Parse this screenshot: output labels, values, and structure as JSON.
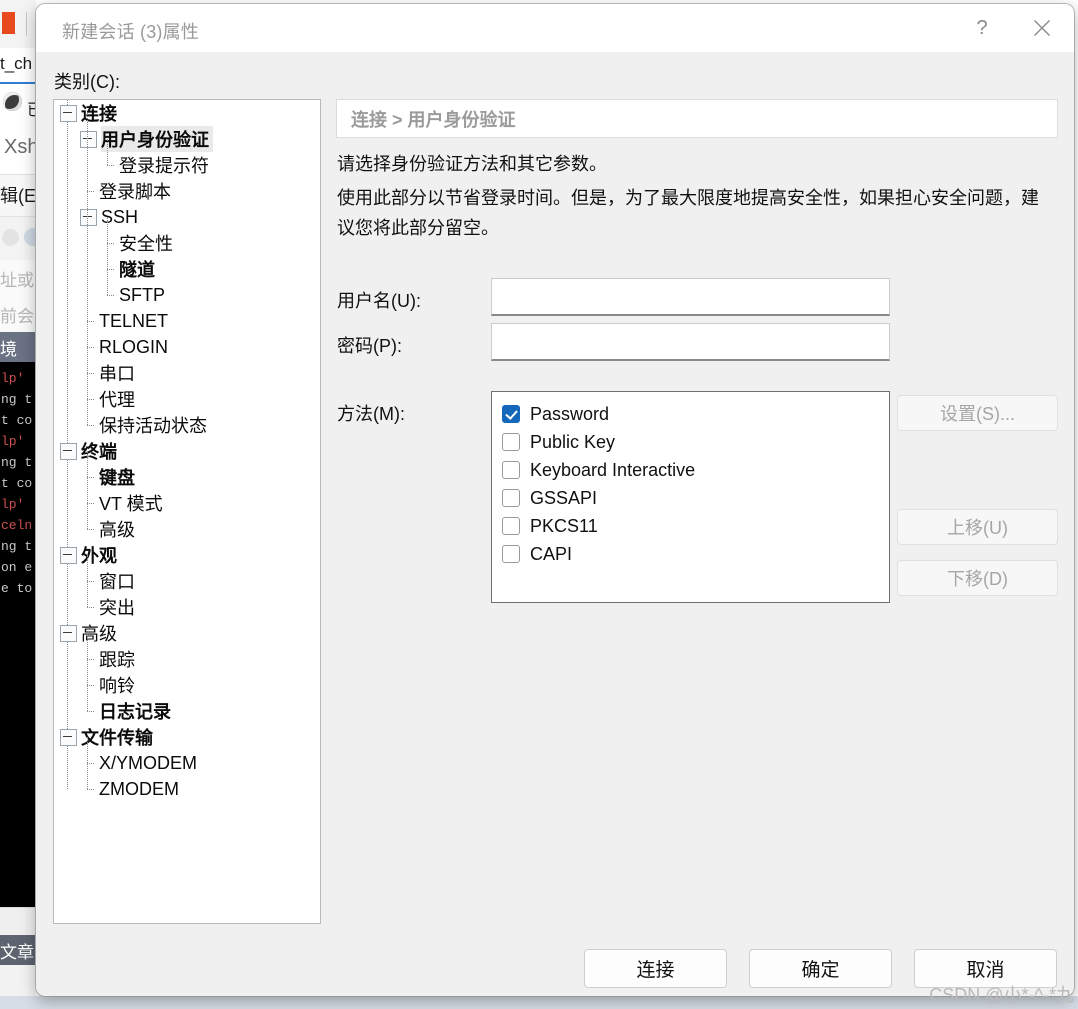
{
  "background": {
    "tab_text": "t_ch",
    "address_text": "已",
    "app_name": "Xsh",
    "menu_text": "辑(E)",
    "hint_1": "址或",
    "hint_2": "前会i",
    "selected_item": "境",
    "terminal_lines": [
      "lp'",
      "",
      "ng t",
      "t co",
      "",
      "lp'",
      "",
      "ng t",
      "t co",
      "",
      "lp'",
      "celn",
      "",
      "ng t",
      "on e",
      "e to"
    ],
    "taskbar_item": "文章"
  },
  "dialog": {
    "title": "新建会话 (3)属性",
    "help_label": "?",
    "category_label": "类别(C):"
  },
  "tree": {
    "items": [
      {
        "label": "连接",
        "indent": 0,
        "bold": true,
        "expander": "minus",
        "selected": false
      },
      {
        "label": "用户身份验证",
        "indent": 1,
        "bold": true,
        "expander": "minus",
        "selected": true
      },
      {
        "label": "登录提示符",
        "indent": 2,
        "bold": false,
        "expander": "leaf",
        "selected": false
      },
      {
        "label": "登录脚本",
        "indent": 1,
        "bold": false,
        "expander": "leaf",
        "selected": false
      },
      {
        "label": "SSH",
        "indent": 1,
        "bold": false,
        "expander": "minus",
        "selected": false
      },
      {
        "label": "安全性",
        "indent": 2,
        "bold": false,
        "expander": "leaf",
        "selected": false
      },
      {
        "label": "隧道",
        "indent": 2,
        "bold": true,
        "expander": "leaf",
        "selected": false
      },
      {
        "label": "SFTP",
        "indent": 2,
        "bold": false,
        "expander": "leaf",
        "selected": false
      },
      {
        "label": "TELNET",
        "indent": 1,
        "bold": false,
        "expander": "leaf",
        "selected": false
      },
      {
        "label": "RLOGIN",
        "indent": 1,
        "bold": false,
        "expander": "leaf",
        "selected": false
      },
      {
        "label": "串口",
        "indent": 1,
        "bold": false,
        "expander": "leaf",
        "selected": false
      },
      {
        "label": "代理",
        "indent": 1,
        "bold": false,
        "expander": "leaf",
        "selected": false
      },
      {
        "label": "保持活动状态",
        "indent": 1,
        "bold": false,
        "expander": "leaf",
        "selected": false
      },
      {
        "label": "终端",
        "indent": 0,
        "bold": true,
        "expander": "minus",
        "selected": false
      },
      {
        "label": "键盘",
        "indent": 1,
        "bold": true,
        "expander": "leaf",
        "selected": false
      },
      {
        "label": "VT 模式",
        "indent": 1,
        "bold": false,
        "expander": "leaf",
        "selected": false
      },
      {
        "label": "高级",
        "indent": 1,
        "bold": false,
        "expander": "leaf",
        "selected": false
      },
      {
        "label": "外观",
        "indent": 0,
        "bold": true,
        "expander": "minus",
        "selected": false
      },
      {
        "label": "窗口",
        "indent": 1,
        "bold": false,
        "expander": "leaf",
        "selected": false
      },
      {
        "label": "突出",
        "indent": 1,
        "bold": false,
        "expander": "leaf",
        "selected": false
      },
      {
        "label": "高级",
        "indent": 0,
        "bold": false,
        "expander": "minus",
        "selected": false
      },
      {
        "label": "跟踪",
        "indent": 1,
        "bold": false,
        "expander": "leaf",
        "selected": false
      },
      {
        "label": "响铃",
        "indent": 1,
        "bold": false,
        "expander": "leaf",
        "selected": false
      },
      {
        "label": "日志记录",
        "indent": 1,
        "bold": true,
        "expander": "leaf",
        "selected": false
      },
      {
        "label": "文件传输",
        "indent": 0,
        "bold": true,
        "expander": "minus",
        "selected": false
      },
      {
        "label": "X/YMODEM",
        "indent": 1,
        "bold": false,
        "expander": "leaf",
        "selected": false
      },
      {
        "label": "ZMODEM",
        "indent": 1,
        "bold": false,
        "expander": "leaf",
        "selected": false
      }
    ]
  },
  "pane": {
    "breadcrumb": "连接 > 用户身份验证",
    "description_1": "请选择身份验证方法和其它参数。",
    "description_2": "使用此部分以节省登录时间。但是，为了最大限度地提高安全性，如果担心安全问题，建议您将此部分留空。",
    "username_label": "用户名(U):",
    "username_value": "",
    "username_placeholder": "",
    "password_label": "密码(P):",
    "password_value": "",
    "password_placeholder": "",
    "method_label": "方法(M):",
    "methods": [
      {
        "label": "Password",
        "checked": true
      },
      {
        "label": "Public Key",
        "checked": false
      },
      {
        "label": "Keyboard Interactive",
        "checked": false
      },
      {
        "label": "GSSAPI",
        "checked": false
      },
      {
        "label": "PKCS11",
        "checked": false
      },
      {
        "label": "CAPI",
        "checked": false
      }
    ],
    "settings_button": "设置(S)...",
    "moveup_button": "上移(U)",
    "movedown_button": "下移(D)"
  },
  "footer": {
    "connect_button": "连接",
    "ok_button": "确定",
    "cancel_button": "取消"
  },
  "watermark": "CSDN @小*-^-*九",
  "colors": {
    "accent": "#1567ba",
    "dialog_bg": "#f0f0f0",
    "titlebar_bg": "#ffffff",
    "disabled_text": "#a6a6a6"
  }
}
